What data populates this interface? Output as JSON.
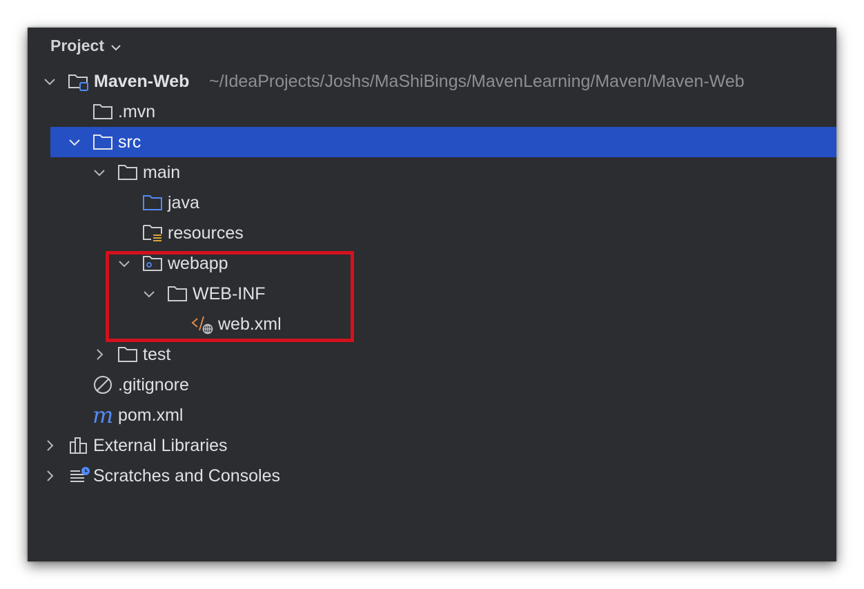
{
  "panel": {
    "title": "Project"
  },
  "tree": {
    "root": {
      "label": "Maven-Web",
      "path": "~/IdeaProjects/Joshs/MaShiBings/MavenLearning/Maven/Maven-Web"
    },
    "mvn": {
      "label": ".mvn"
    },
    "src": {
      "label": "src"
    },
    "main": {
      "label": "main"
    },
    "java": {
      "label": "java"
    },
    "resources": {
      "label": "resources"
    },
    "webapp": {
      "label": "webapp"
    },
    "webinf": {
      "label": "WEB-INF"
    },
    "webxml": {
      "label": "web.xml"
    },
    "test": {
      "label": "test"
    },
    "gitignore": {
      "label": ".gitignore"
    },
    "pom": {
      "label": "pom.xml",
      "icon_glyph": "m"
    },
    "external": {
      "label": "External Libraries"
    },
    "scratches": {
      "label": "Scratches and Consoles"
    }
  },
  "colors": {
    "background": "#2b2d30",
    "selection": "#2450c4",
    "highlight": "#d4111e",
    "text": "#dfe1e5",
    "path": "#8c8f94",
    "accent_blue": "#548af7",
    "xml_orange": "#e0894c",
    "resources_yellow": "#d8a63a"
  },
  "icons": {
    "folder": "folder-icon",
    "module": "module-folder-icon",
    "source_root": "source-folder-icon",
    "resources_root": "resources-folder-icon",
    "web_root": "web-folder-icon",
    "xml": "web-xml-icon",
    "ignore": "gitignore-icon",
    "maven": "maven-pom-icon",
    "libraries": "libraries-icon",
    "scratches": "scratches-icon"
  }
}
